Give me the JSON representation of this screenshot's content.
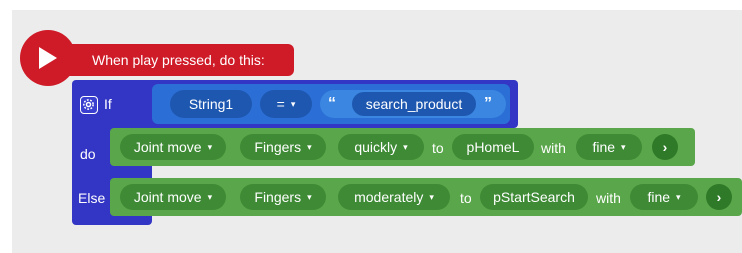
{
  "event": {
    "label": "When play pressed, do this:"
  },
  "if_block": {
    "if_label": "If",
    "do_label": "do",
    "else_label": "Else",
    "condition": {
      "variable": "String1",
      "operator": "=",
      "open_quote": "“",
      "string_value": "search_product",
      "close_quote": "”"
    }
  },
  "do_action": {
    "action": "Joint move",
    "target": "Fingers",
    "speed": "quickly",
    "to_label": "to",
    "destination": "pHomeL",
    "with_label": "with",
    "precision": "fine"
  },
  "else_action": {
    "action": "Joint move",
    "target": "Fingers",
    "speed": "moderately",
    "to_label": "to",
    "destination": "pStartSearch",
    "with_label": "with",
    "precision": "fine"
  },
  "glyphs": {
    "dropdown": "▾",
    "arrow": "›"
  },
  "colors": {
    "event_red": "#cf1a27",
    "if_blue": "#3336c4",
    "logic_blue": "#2b6fd6",
    "action_green": "#5aa64a"
  }
}
